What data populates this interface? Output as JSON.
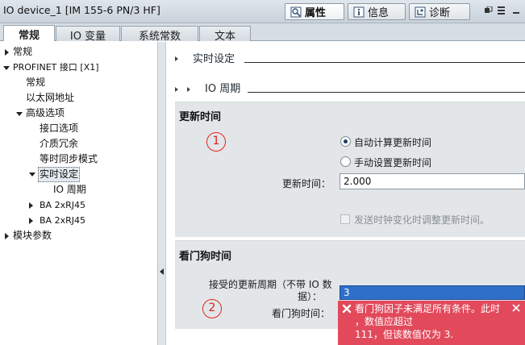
{
  "window": {
    "title": "IO device_1 [IM 155-6 PN/3 HF]"
  },
  "inspector_tabs": [
    {
      "label": "属性",
      "icon": "properties-icon",
      "active": true
    },
    {
      "label": "信息",
      "icon": "info-icon",
      "active": false
    },
    {
      "label": "诊断",
      "icon": "diagnostics-icon",
      "active": false
    }
  ],
  "tabs": [
    {
      "label": "常规",
      "active": true
    },
    {
      "label": "IO 变量",
      "active": false
    },
    {
      "label": "系统常数",
      "active": false
    },
    {
      "label": "文本",
      "active": false
    }
  ],
  "nav": {
    "items": [
      {
        "label": "常规",
        "level": 0,
        "expander": "collapsed"
      },
      {
        "label": "PROFINET 接口 [X1]",
        "level": 0,
        "expander": "expanded"
      },
      {
        "label": "常规",
        "level": 1,
        "expander": "none"
      },
      {
        "label": "以太网地址",
        "level": 1,
        "expander": "none"
      },
      {
        "label": "高级选项",
        "level": 1,
        "expander": "expanded"
      },
      {
        "label": "接口选项",
        "level": 2,
        "expander": "none"
      },
      {
        "label": "介质冗余",
        "level": 2,
        "expander": "none"
      },
      {
        "label": "等时同步模式",
        "level": 2,
        "expander": "none"
      },
      {
        "label": "实时设定",
        "level": 2,
        "expander": "expanded",
        "selected": true
      },
      {
        "label": "IO 周期",
        "level": 3,
        "expander": "none"
      },
      {
        "label": "BA 2xRJ45",
        "level": 1,
        "expander": "collapsed"
      },
      {
        "label": "BA 2xRJ45",
        "level": 1,
        "expander": "collapsed"
      },
      {
        "label": "模块参数",
        "level": 0,
        "expander": "collapsed"
      }
    ]
  },
  "content": {
    "section_realtime": "实时设定",
    "section_io_cycle": "IO 周期",
    "update_time": {
      "title": "更新时间",
      "marker": "1",
      "radio_auto": "自动计算更新时间",
      "radio_manual": "手动设置更新时间",
      "selected": "auto",
      "field_label": "更新时间：",
      "field_value": "2.000",
      "checkbox_label": "发送时钟变化时调整更新时间。",
      "checkbox_checked": false,
      "checkbox_enabled": false
    },
    "watchdog": {
      "title": "看门狗时间",
      "marker": "2",
      "accepted_label_line1": "接受的更新周期（不带 IO 数",
      "accepted_label_line2": "据）：",
      "accepted_value": "3",
      "watchdog_label": "看门狗时间："
    },
    "error": {
      "line1": "看门狗因子未满足所有条件。此时",
      "line2": "，数值应超过",
      "line3": "111，但该数值仅为 3."
    }
  },
  "colors": {
    "error_bg": "#e24a5c",
    "selection_blue": "#2f6fc8",
    "marker_red": "#e0251e"
  }
}
